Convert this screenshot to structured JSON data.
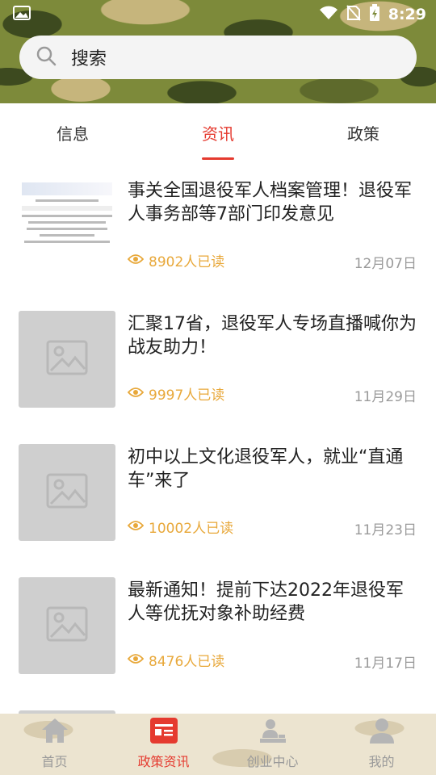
{
  "status_bar": {
    "time": "8:29"
  },
  "search": {
    "label": "搜索"
  },
  "tabs": [
    {
      "label": "信息"
    },
    {
      "label": "资讯"
    },
    {
      "label": "政策"
    }
  ],
  "active_tab": "资讯",
  "articles": [
    {
      "title": "事关全国退役军人档案管理！退役军人事务部等7部门印发意见",
      "reads": "8902人已读",
      "date": "12月07日"
    },
    {
      "title": "汇聚17省，退役军人专场直播喊你为战友助力！",
      "reads": "9997人已读",
      "date": "11月29日"
    },
    {
      "title": "初中以上文化退役军人，就业“直通车”来了",
      "reads": "10002人已读",
      "date": "11月23日"
    },
    {
      "title": "最新通知！提前下达2022年退役军人等优抚对象补助经费",
      "reads": "8476人已读",
      "date": "11月17日"
    }
  ],
  "bottom_nav": [
    {
      "label": "首页"
    },
    {
      "label": "政策资讯"
    },
    {
      "label": "创业中心"
    },
    {
      "label": "我的"
    }
  ],
  "colors": {
    "accent": "#e53a2f",
    "reads": "#e8a83a",
    "date": "#9a9a9a"
  }
}
